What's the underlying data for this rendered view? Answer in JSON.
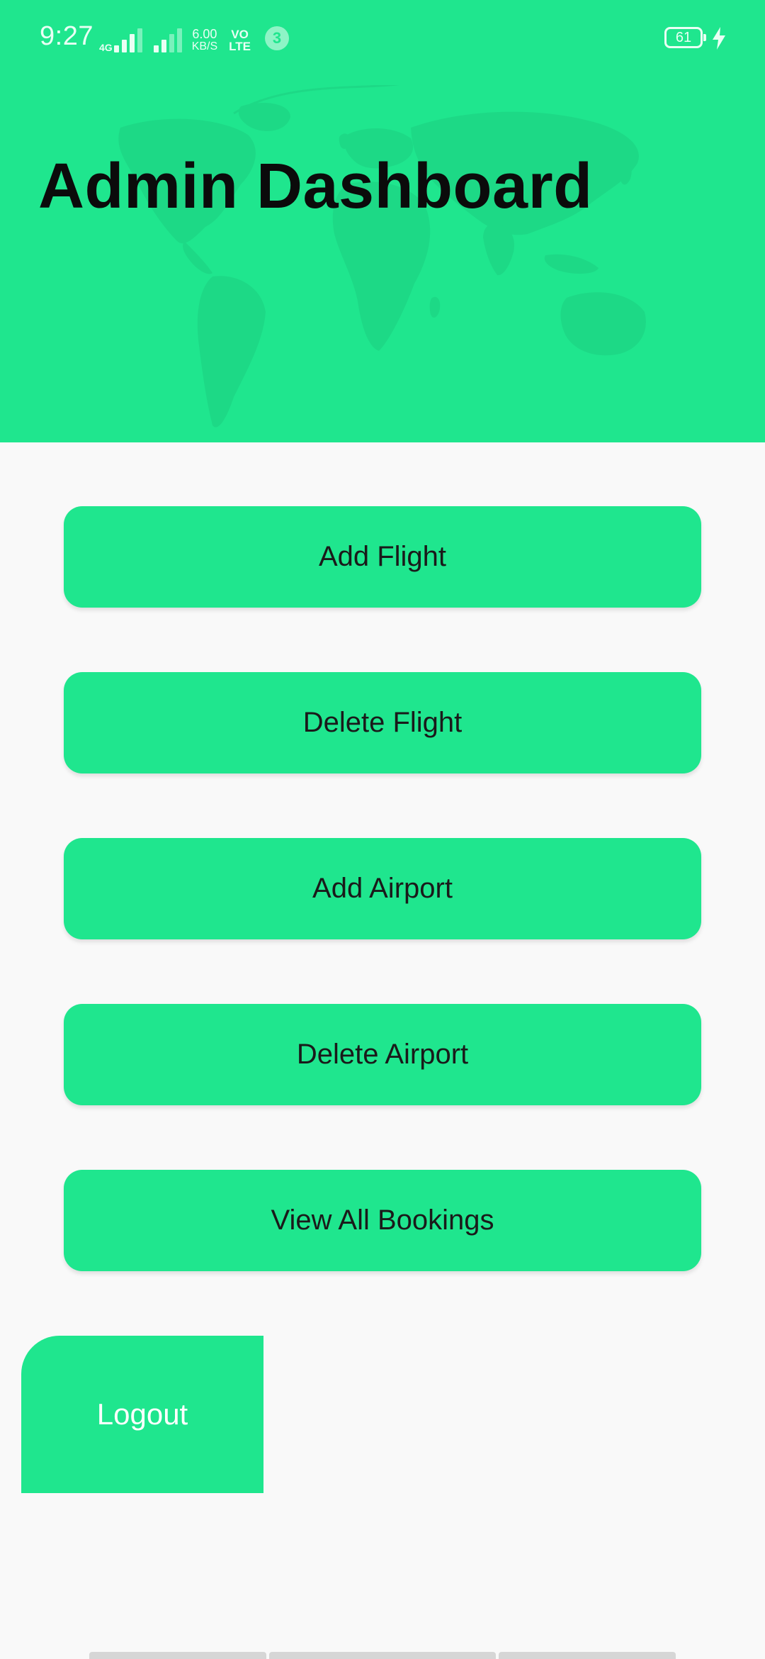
{
  "status_bar": {
    "time": "9:27",
    "network_type": "4G",
    "speed_value": "6.00",
    "speed_unit": "KB/S",
    "volte_top": "VO",
    "volte_bottom": "LTE",
    "notification_count": "3",
    "battery_level": "61"
  },
  "header": {
    "title": "Admin Dashboard"
  },
  "menu": {
    "buttons": [
      {
        "label": "Add Flight"
      },
      {
        "label": "Delete Flight"
      },
      {
        "label": "Add Airport"
      },
      {
        "label": "Delete Airport"
      },
      {
        "label": "View All Bookings"
      }
    ]
  },
  "logout": {
    "label": "Logout"
  },
  "colors": {
    "accent": "#1fe68e",
    "background": "#f9f9f9",
    "title_text": "#0b0b0b"
  }
}
